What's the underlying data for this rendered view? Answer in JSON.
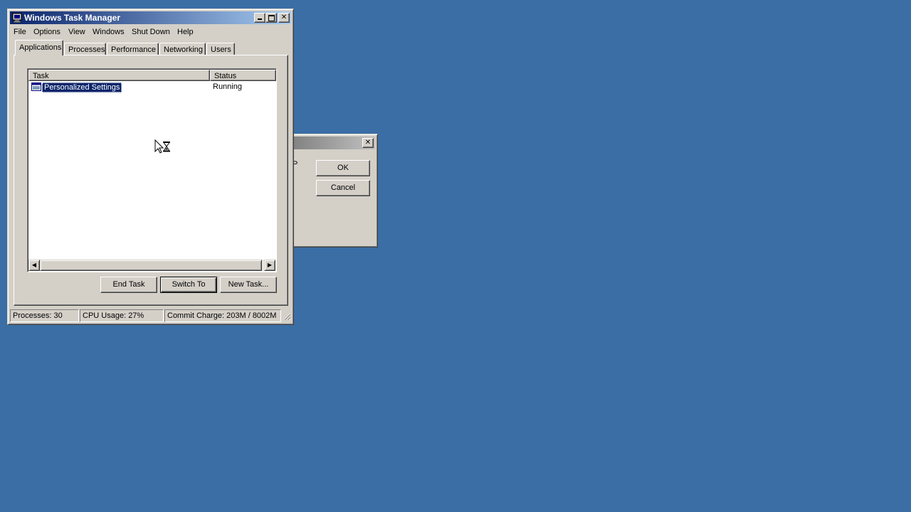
{
  "desktop": {
    "background_color": "#3a6ea5"
  },
  "task_manager": {
    "title": "Windows Task Manager",
    "title_icon": "computer-icon",
    "caption_buttons": {
      "minimize": "minimize-icon",
      "maximize": "maximize-icon",
      "close": "close-icon"
    },
    "menu": [
      "File",
      "Options",
      "View",
      "Windows",
      "Shut Down",
      "Help"
    ],
    "tabs": [
      {
        "label": "Applications",
        "active": true
      },
      {
        "label": "Processes",
        "active": false
      },
      {
        "label": "Performance",
        "active": false
      },
      {
        "label": "Networking",
        "active": false
      },
      {
        "label": "Users",
        "active": false
      }
    ],
    "applications": {
      "columns": {
        "task": "Task",
        "status": "Status"
      },
      "rows": [
        {
          "task": "Personalized Settings",
          "status": "Running",
          "selected": true,
          "icon": "window-icon"
        }
      ]
    },
    "buttons": {
      "end_task": "End Task",
      "switch_to": "Switch To",
      "new_task": "New Task..."
    },
    "status_bar": {
      "processes": "Processes: 30",
      "cpu": "CPU Usage: 27%",
      "commit": "Commit Charge: 203M / 8002M"
    }
  },
  "dialog": {
    "fragment_text": "P",
    "ok_label": "OK",
    "cancel_label": "Cancel",
    "close_icon": "close-icon"
  },
  "cursor": {
    "type": "arrow-hourglass-busy-icon"
  }
}
